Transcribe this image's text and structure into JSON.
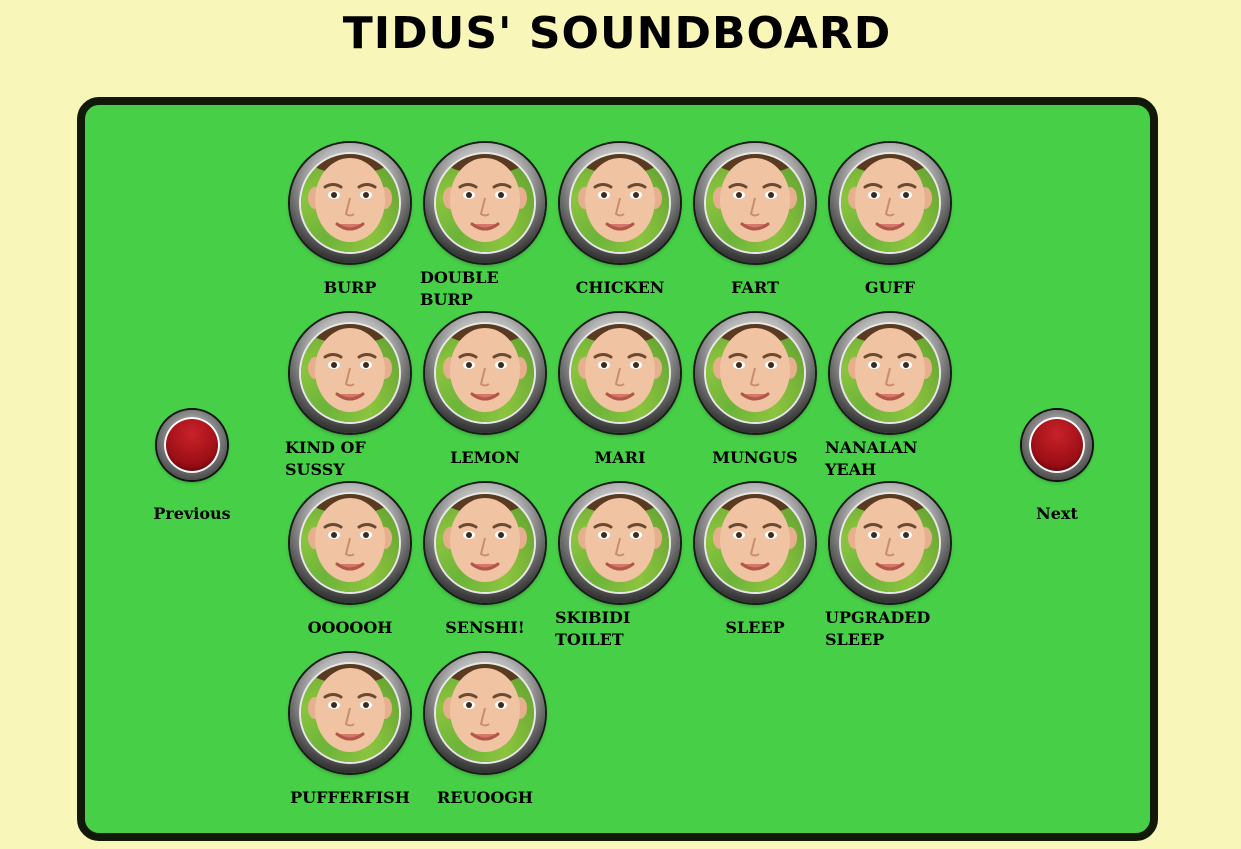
{
  "title": "TIDUS' SOUNDBOARD",
  "nav": {
    "previous_label": "Previous",
    "next_label": "Next"
  },
  "sounds": [
    {
      "label": "BURP"
    },
    {
      "label": "DOUBLE BURP"
    },
    {
      "label": "CHICKEN"
    },
    {
      "label": "FART"
    },
    {
      "label": "GUFF"
    },
    {
      "label": "KIND OF SUSSY"
    },
    {
      "label": "LEMON"
    },
    {
      "label": "MARI"
    },
    {
      "label": "MUNGUS"
    },
    {
      "label": "NANALAN YEAH"
    },
    {
      "label": "OOOOOH"
    },
    {
      "label": "SENSHI!"
    },
    {
      "label": "SKIBIDI TOILET"
    },
    {
      "label": "SLEEP"
    },
    {
      "label": "UPGRADED SLEEP"
    },
    {
      "label": "PUFFERFISH"
    },
    {
      "label": "REUOOGH"
    }
  ],
  "colors": {
    "page_background": "#f8f6b8",
    "board_background": "#47cf47",
    "board_border": "#111a08",
    "nav_button_red": "#9d0f16"
  },
  "icons": {
    "sound_button": "boy-face-icon",
    "nav_button": "red-round-button-icon"
  }
}
